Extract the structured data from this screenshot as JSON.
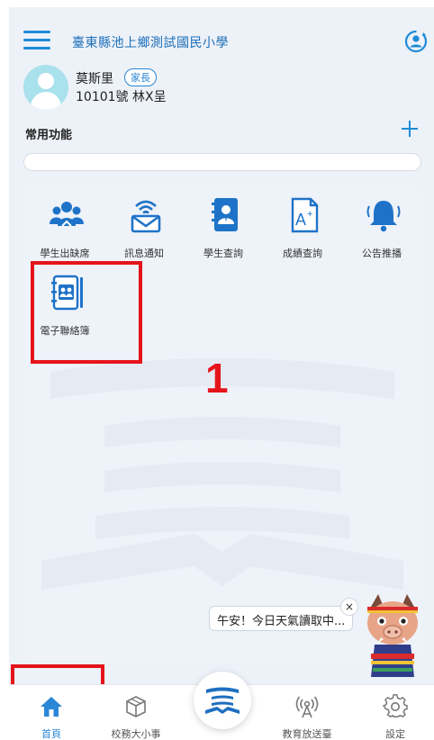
{
  "header": {
    "school_name": "臺東縣池上鄉測試國民小學",
    "menu_icon": "hamburger-menu-icon",
    "account_icon": "switch-account-icon"
  },
  "profile": {
    "name": "莫斯里",
    "role_badge": "家長",
    "seat": "10101號 林X呈"
  },
  "favorites": {
    "title": "常用功能",
    "add_icon": "plus-icon"
  },
  "functions": [
    {
      "label": "學生出缺席",
      "icon": "attendance-icon"
    },
    {
      "label": "訊息通知",
      "icon": "message-notification-icon"
    },
    {
      "label": "學生查詢",
      "icon": "student-search-icon"
    },
    {
      "label": "成績查詢",
      "icon": "grade-query-icon"
    },
    {
      "label": "公告推播",
      "icon": "announcement-bell-icon"
    },
    {
      "label": "電子聯絡簿",
      "icon": "contact-book-icon"
    }
  ],
  "annotation": {
    "step_number": "1"
  },
  "weather_bubble": {
    "text": "午安！今日天氣讀取中...",
    "close": "×"
  },
  "bottom_nav": [
    {
      "label": "首頁",
      "icon": "home-icon",
      "active": true
    },
    {
      "label": "校務大小事",
      "icon": "cube-icon",
      "active": false
    },
    {
      "label": "",
      "icon": "center-logo-icon",
      "active": false
    },
    {
      "label": "教育放送臺",
      "icon": "broadcast-icon",
      "active": false
    },
    {
      "label": "設定",
      "icon": "gear-icon",
      "active": false
    }
  ],
  "colors": {
    "accent": "#1d8bd8",
    "highlight": "#e5141b",
    "background": "#edf1f8"
  }
}
